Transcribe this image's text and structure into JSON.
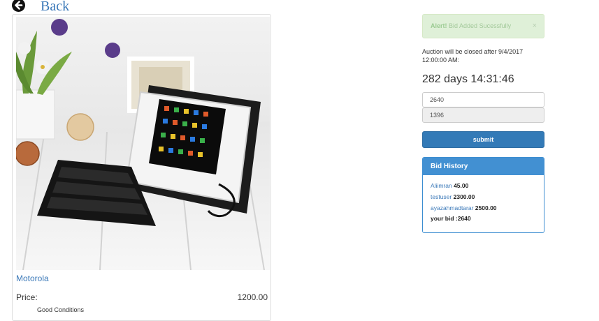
{
  "nav": {
    "back_label": "Back"
  },
  "product": {
    "name": "Motorola",
    "price_label": "Price:",
    "price_value": "1200.00",
    "condition": "Good Conditions"
  },
  "alert": {
    "strong": "Alert!",
    "message": "Bid Added Sucessfully",
    "close": "×"
  },
  "auction": {
    "closing_text": "Auction will be closed after 9/4/2017 12:00:00 AM:",
    "countdown": "282 days 14:31:46"
  },
  "bid_form": {
    "bid_value": "2640",
    "current_value": "1396",
    "submit_label": "submit"
  },
  "history": {
    "title": "Bid History",
    "entries": [
      {
        "user": "Aliimran",
        "amount": "45.00"
      },
      {
        "user": "testuser",
        "amount": "2300.00"
      },
      {
        "user": "ayazahmadtarar",
        "amount": "2500.00"
      }
    ],
    "your_bid": "your bid :2640"
  },
  "colors": {
    "link": "#3a78b8",
    "primary": "#337ab7",
    "panel_heading": "#4290d2",
    "alert_bg": "#dff0d8"
  }
}
